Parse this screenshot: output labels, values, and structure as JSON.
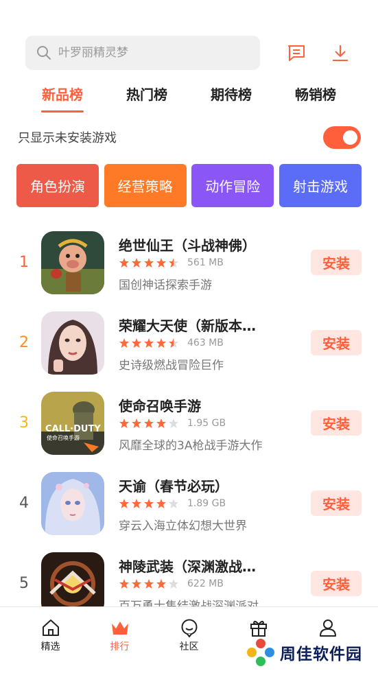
{
  "search": {
    "placeholder": "叶罗丽精灵梦"
  },
  "tabs": [
    {
      "label": "新品榜",
      "active": true
    },
    {
      "label": "热门榜",
      "active": false
    },
    {
      "label": "期待榜",
      "active": false
    },
    {
      "label": "畅销榜",
      "active": false
    }
  ],
  "filter": {
    "label": "只显示未安装游戏",
    "enabled": true
  },
  "categories": [
    {
      "label": "角色扮演",
      "color": "#ee5a48"
    },
    {
      "label": "经营策略",
      "color": "#ff7a26"
    },
    {
      "label": "动作冒险",
      "color": "#8a56f5"
    },
    {
      "label": "射击游戏",
      "color": "#5b6cf6"
    }
  ],
  "games": [
    {
      "rank": "1",
      "rank_color": "#ff5f3b",
      "name": "绝世仙王（斗战神佛）",
      "rating": 4.5,
      "size": "561 MB",
      "desc": "国创神话探索手游",
      "install": "安装"
    },
    {
      "rank": "2",
      "rank_color": "#ff8c1a",
      "name": "荣耀大天使（新版本…",
      "rating": 4.5,
      "size": "463 MB",
      "desc": "史诗级燃战冒险巨作",
      "install": "安装"
    },
    {
      "rank": "3",
      "rank_color": "#f5b51a",
      "name": "使命召唤手游",
      "rating": 4,
      "size": "1.95 GB",
      "desc": "风靡全球的3A枪战手游大作",
      "install": "安装"
    },
    {
      "rank": "4",
      "rank_color": "#555555",
      "name": "天谕（春节必玩）",
      "rating": 4,
      "size": "1.89 GB",
      "desc": "穿云入海立体幻想大世界",
      "install": "安装"
    },
    {
      "rank": "5",
      "rank_color": "#555555",
      "name": "神陵武装（深渊激战…",
      "rating": 4,
      "size": "622 MB",
      "desc": "百万勇士集结激战深渊派对",
      "install": "安装"
    }
  ],
  "icon_art": {
    "game1_text": "",
    "game3_text": "CALL·DUTY",
    "game3_sub": "使命召唤手游"
  },
  "nav": [
    {
      "label": "精选",
      "icon": "home-icon",
      "active": false
    },
    {
      "label": "排行",
      "icon": "crown-icon",
      "active": true
    },
    {
      "label": "社区",
      "icon": "community-icon",
      "active": false
    },
    {
      "label": "福利",
      "icon": "gift-icon",
      "active": false
    },
    {
      "label": "我的",
      "icon": "profile-icon",
      "active": false
    }
  ],
  "watermark": {
    "text": "周佳软件园"
  },
  "colors": {
    "accent": "#ff5f3b",
    "star": "#ff6a3d",
    "star_empty": "#dddddd"
  }
}
